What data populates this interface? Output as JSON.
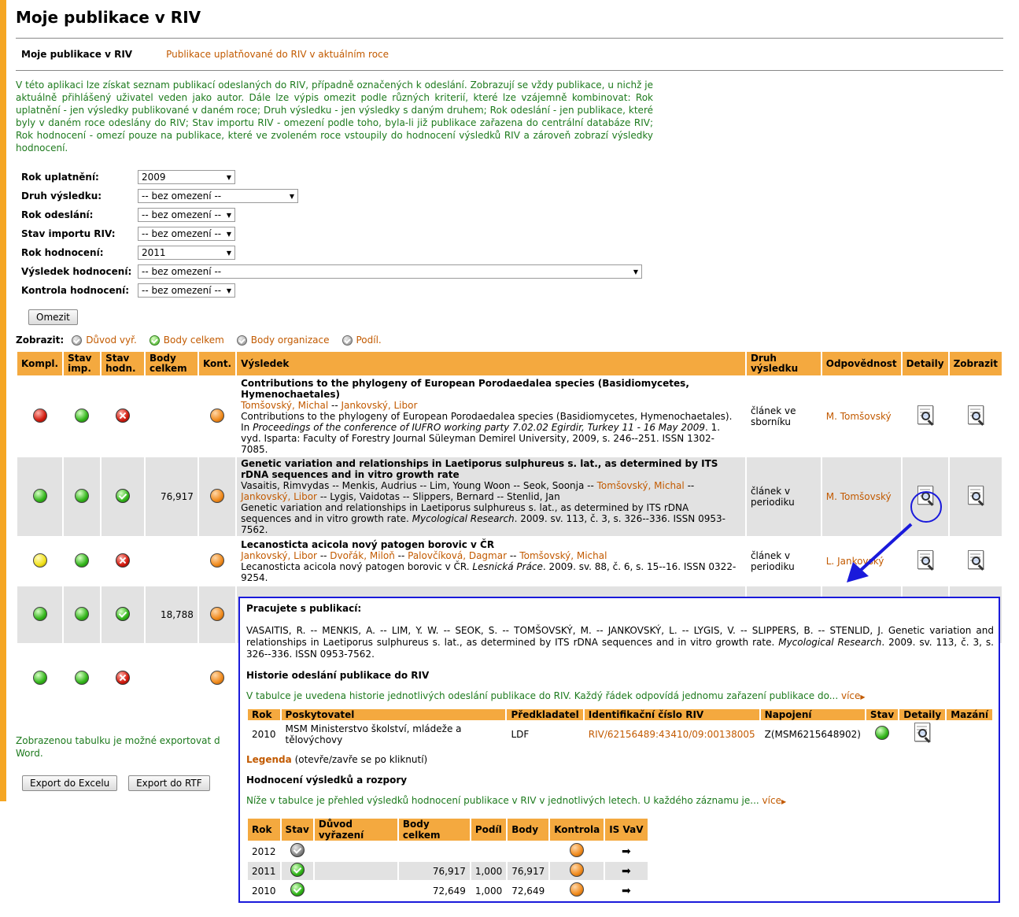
{
  "page": {
    "title": "Moje publikace v RIV",
    "tabs": {
      "active": "Moje publikace v RIV",
      "link": "Publikace uplatňované do RIV v aktuálním roce"
    },
    "intro": "V této aplikaci lze získat seznam publikací odeslaných do RIV, případně označených k odeslání. Zobrazují se vždy publikace, u nichž je aktuálně přihlášený uživatel veden jako autor. Dále lze výpis omezit podle různých kriterií, které lze vzájemně kombinovat: Rok uplatnění - jen výsledky publikované v daném roce; Druh výsledku - jen výsledky s daným druhem; Rok odeslání - jen publikace, které byly v daném roce odeslány do RIV; Stav importu RIV - omezení podle toho, byla-li již publikace zařazena do centrální databáze RIV; Rok hodnocení - omezí pouze na publikace, které ve zvoleném roce vstoupily do hodnocení výsledků RIV a zároveň zobrazí výsledky hodnocení."
  },
  "filters": {
    "rok_uplatneni": {
      "label": "Rok uplatnění:",
      "value": "2009"
    },
    "druh_vysledku": {
      "label": "Druh výsledku:",
      "value": "-- bez omezení --"
    },
    "rok_odeslani": {
      "label": "Rok odeslání:",
      "value": "-- bez omezení --"
    },
    "stav_importu": {
      "label": "Stav importu RIV:",
      "value": "-- bez omezení --"
    },
    "rok_hodnoceni": {
      "label": "Rok hodnocení:",
      "value": "2011"
    },
    "vysledek_hodnoceni": {
      "label": "Výsledek hodnocení:",
      "value": "-- bez omezení --"
    },
    "kontrola_hodnoceni": {
      "label": "Kontrola hodnocení:",
      "value": "-- bez omezení --"
    },
    "submit_label": "Omezit"
  },
  "display": {
    "label": "Zobrazit:",
    "options": [
      "Důvod vyř.",
      "Body celkem",
      "Body organizace",
      "Podíl."
    ]
  },
  "table": {
    "headers": {
      "kompl": "Kompl.",
      "stav_imp": "Stav imp.",
      "stav_hodn": "Stav hodn.",
      "body": "Body celkem",
      "kont": "Kont.",
      "vysledek": "Výsledek",
      "druh": "Druh výsledku",
      "odpov": "Odpovědnost",
      "detaily": "Detaily",
      "zobrazit": "Zobrazit"
    },
    "rows": [
      {
        "title": "Contributions to the phylogeny of European Porodaedalea species (Basidiomycetes, Hymenochaetales)",
        "authors": [
          "Tomšovský, Michal",
          "Jankovský, Libor"
        ],
        "cite_plain": "Contributions to the phylogeny of European Porodaedalea species (Basidiomycetes, Hymenochaetales). In ",
        "cite_italic": "Proceedings of the conference of IUFRO working party 7.02.02 Egirdir, Turkey 11 - 16 May 2009",
        "cite_tail": ". 1. vyd. Isparta: Faculty of Forestry Journal Süleyman Demirel University, 2009, s. 246--251. ISSN 1302-7085.",
        "druh": "článek ve sborníku",
        "odpov": "M. Tomšovský",
        "body": ""
      },
      {
        "title": "Genetic variation and relationships in Laetiporus sulphureus s. lat., as determined by ITS rDNA sequences and in vitro growth rate",
        "authors_plain1": "Vasaitis, Rimvydas -- Menkis, Audrius -- Lim, Young Woon -- Seok, Soonja -- ",
        "authors_link1": "Tomšovský, Michal",
        "authors_link2": "Jankovský, Libor",
        "authors_plain2": " -- Lygis, Vaidotas -- Slippers, Bernard -- Stenlid, Jan",
        "cite_plain": "Genetic variation and relationships in Laetiporus sulphureus s. lat., as determined by ITS rDNA sequences and in vitro growth rate. ",
        "cite_italic": "Mycological Research",
        "cite_tail": ". 2009. sv. 113, č. 3, s. 326--336. ISSN 0953-7562.",
        "druh": "článek v periodiku",
        "odpov": "M. Tomšovský",
        "body": "76,917"
      },
      {
        "title": "Lecanosticta acicola nový patogen borovic v ČR",
        "authors": [
          "Jankovský, Libor",
          "Dvořák, Miloň",
          "Palovčíková, Dagmar",
          "Tomšovský, Michal"
        ],
        "cite_plain": "Lecanosticta acicola nový patogen borovic v ČR. ",
        "cite_italic": "Lesnická Práce",
        "cite_tail": ". 2009. sv. 88, č. 6, s. 15--16. ISSN 0322-9254.",
        "druh": "článek v periodiku",
        "odpov": "L. Jankovský",
        "body": ""
      },
      {
        "body": "18,788"
      },
      {
        "body": ""
      }
    ]
  },
  "export": {
    "note_line1": "Zobrazenou tabulku je možné exportovat d",
    "note_line2": "Word.",
    "excel_label": "Export do Excelu",
    "rtf_label": "Export do RTF"
  },
  "popup": {
    "heading": "Pracujete s publikací:",
    "citation_plain": "VASAITIS, R. -- MENKIS, A. -- LIM, Y. W. -- SEOK, S. -- TOMŠOVSKÝ, M. -- JANKOVSKÝ, L. -- LYGIS, V. -- SLIPPERS, B. -- STENLID, J. Genetic variation and relationships in Laetiporus sulphureus s. lat., as determined by ITS rDNA sequences and in vitro growth rate. ",
    "citation_italic": "Mycological Research",
    "citation_tail": ". 2009. sv. 113, č. 3, s. 326--336. ISSN 0953-7562.",
    "history_heading": "Historie odeslání publikace do RIV",
    "history_note": "V tabulce je uvedena historie jednotlivých odeslání publikace do RIV. Každý řádek odpovídá jednomu zařazení publikace do...",
    "more": "více",
    "history_headers": [
      "Rok",
      "Poskytovatel",
      "Předkladatel",
      "Identifikační číslo RIV",
      "Napojení",
      "Stav",
      "Detaily",
      "Mazání"
    ],
    "history_row": {
      "rok": "2010",
      "poskytovatel": "MSM Ministerstvo školství, mládeže a tělovýchovy",
      "predkladatel": "LDF",
      "id": "RIV/62156489:43410/09:00138005",
      "napojeni": "Z(MSM6215648902)"
    },
    "legend_link": "Legenda",
    "legend_note": " (otevře/zavře se po kliknutí)",
    "eval_heading": "Hodnocení výsledků a rozpory",
    "eval_note": "Níže v tabulce je přehled výsledků hodnocení publikace v RIV v jednotlivých letech. U každého záznamu je...",
    "eval_headers": [
      "Rok",
      "Stav",
      "Důvod vyřazení",
      "Body celkem",
      "Podíl",
      "Body",
      "Kontrola",
      "IS VaV"
    ],
    "eval_rows": [
      {
        "rok": "2012",
        "duvod": "",
        "body_celkem": "",
        "podil": "",
        "body": ""
      },
      {
        "rok": "2011",
        "duvod": "",
        "body_celkem": "76,917",
        "podil": "1,000",
        "body": "76,917"
      },
      {
        "rok": "2010",
        "duvod": "",
        "body_celkem": "72,649",
        "podil": "1,000",
        "body": "72,649"
      }
    ]
  }
}
